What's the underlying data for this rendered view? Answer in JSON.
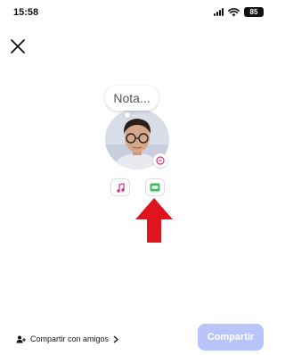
{
  "status_bar": {
    "time": "15:58",
    "battery_level": "85",
    "icons": [
      "signal-icon",
      "wifi-icon",
      "battery-icon"
    ]
  },
  "header": {
    "close_icon": "close-icon"
  },
  "note": {
    "placeholder": "Nota..."
  },
  "profile": {
    "avatar_badge_icon": "edit-note-icon",
    "accent_color": "#e1306c"
  },
  "actions": [
    {
      "name": "music",
      "icon": "music-note-icon",
      "color": "#c13584"
    },
    {
      "name": "gif",
      "icon": "gif-icon",
      "color": "#3bb85c"
    }
  ],
  "annotation": {
    "icon": "red-arrow-icon",
    "color": "#e0141e"
  },
  "footer": {
    "share_friends_label": "Compartir con amigos",
    "share_button_label": "Compartir",
    "share_button_color": "#b9c4fb"
  }
}
